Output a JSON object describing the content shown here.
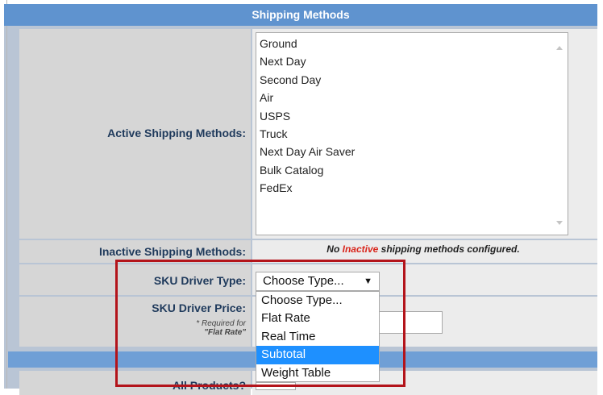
{
  "header": {
    "title": "Shipping Methods"
  },
  "active": {
    "label": "Active Shipping Methods:",
    "items": [
      "Ground",
      "Next Day",
      "Second Day",
      "Air",
      "USPS",
      "Truck",
      "Next Day Air Saver",
      "Bulk Catalog",
      "FedEx"
    ]
  },
  "inactive": {
    "label": "Inactive Shipping Methods:",
    "message_pre": "No ",
    "message_word": "Inactive",
    "message_post": " shipping methods configured."
  },
  "sku_type": {
    "label": "SKU Driver Type:",
    "selected": "Choose Type...",
    "options": [
      "Choose Type...",
      "Flat Rate",
      "Real Time",
      "Subtotal",
      "Weight Table"
    ],
    "highlighted_option": "Subtotal"
  },
  "sku_price": {
    "label": "SKU Driver Price:",
    "note_line1": "* Required for",
    "note_line2": "\"Flat Rate\"",
    "value": ""
  },
  "all_products": {
    "label": "All Products?"
  },
  "colors": {
    "header": "#5f93cf",
    "highlight_border": "#b3141b",
    "selected_option": "#1e90ff",
    "inactive_word": "#d9261c"
  }
}
